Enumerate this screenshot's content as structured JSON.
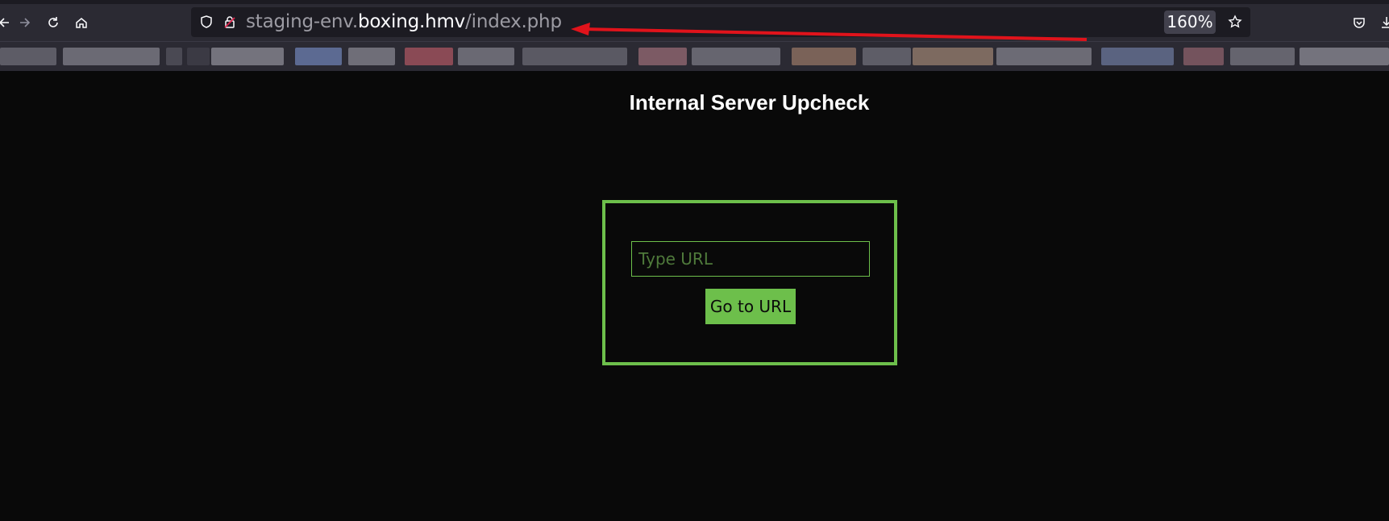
{
  "browser": {
    "url_prefix": "staging-env.",
    "url_domain": "boxing.hmv",
    "url_path": "/index.php",
    "zoom": "160%",
    "icons": [
      "back-arrow-icon",
      "forward-arrow-icon",
      "reload-icon",
      "home-icon",
      "shield-icon",
      "insecure-lock-icon",
      "star-icon",
      "pocket-icon",
      "downloads-icon"
    ],
    "annotation_color": "#e0131b"
  },
  "page": {
    "title": "Internal Server Upcheck",
    "input_placeholder": "Type URL",
    "button_label": "Go to URL",
    "accent_color": "#6dbf4b"
  }
}
